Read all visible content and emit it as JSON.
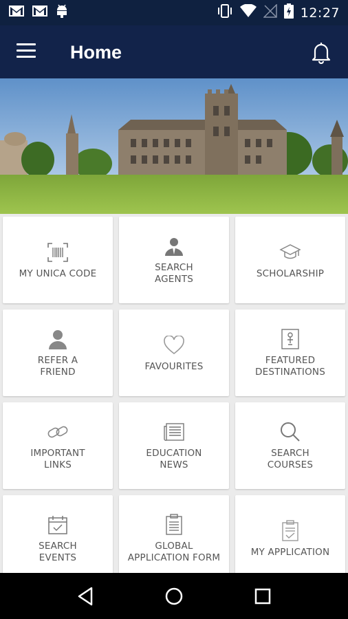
{
  "status_bar": {
    "time": "12:27",
    "left_icons": [
      "gmail-icon",
      "gmail-icon",
      "android-debug-icon"
    ],
    "right_icons": [
      "vibrate-icon",
      "wifi-icon",
      "no-signal-icon",
      "battery-charging-icon"
    ]
  },
  "app_bar": {
    "title": "Home",
    "background": "#12234a"
  },
  "hero": {
    "image": "university-campus-photo"
  },
  "tiles": [
    {
      "label": "MY UNICA CODE",
      "icon": "barcode-scan-icon"
    },
    {
      "label": "SEARCH\nAGENTS",
      "icon": "agent-icon"
    },
    {
      "label": "SCHOLARSHIP",
      "icon": "graduation-cap-icon"
    },
    {
      "label": "REFER A\nFRIEND",
      "icon": "person-icon"
    },
    {
      "label": "FAVOURITES",
      "icon": "heart-icon"
    },
    {
      "label": "FEATURED\nDESTINATIONS",
      "icon": "destination-icon"
    },
    {
      "label": "IMPORTANT\nLINKS",
      "icon": "link-icon"
    },
    {
      "label": "EDUCATION\nNEWS",
      "icon": "newspaper-icon"
    },
    {
      "label": "SEARCH\nCOURSES",
      "icon": "search-icon"
    },
    {
      "label": "SEARCH\nEVENTS",
      "icon": "calendar-check-icon"
    },
    {
      "label": "GLOBAL\nAPPLICATION FORM",
      "icon": "form-icon"
    },
    {
      "label": "MY APPLICATION",
      "icon": "clipboard-check-icon"
    }
  ],
  "nav_bar": {
    "buttons": [
      "back-icon",
      "home-icon",
      "recents-icon"
    ]
  }
}
